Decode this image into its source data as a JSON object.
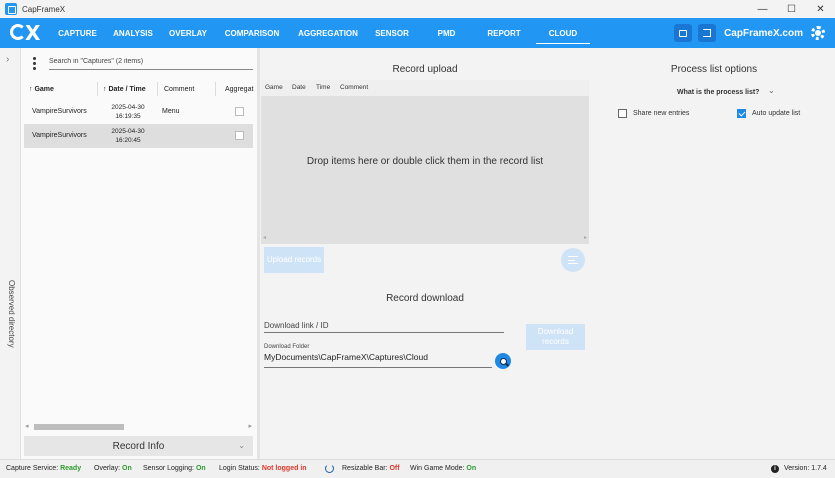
{
  "window": {
    "title": "CapFrameX",
    "controls": [
      "—",
      "☐",
      "✕"
    ]
  },
  "nav": {
    "tabs": [
      {
        "label": "CAPTURE"
      },
      {
        "label": "ANALYSIS"
      },
      {
        "label": "OVERLAY"
      },
      {
        "label": "COMPARISON"
      },
      {
        "label": "AGGREGATION"
      },
      {
        "label": "SENSOR"
      },
      {
        "label": "PMD"
      },
      {
        "label": "REPORT"
      },
      {
        "label": "CLOUD"
      }
    ],
    "active_tab": "CLOUD",
    "site_link": "CapFrameX.com",
    "icons": [
      "screenshot-icon",
      "login-icon",
      "gear-icon"
    ]
  },
  "sidebar": {
    "vertical_label": "Observed directory",
    "toggle": "›"
  },
  "captures": {
    "search_placeholder": "Search in \"Captures\" (2 items)",
    "columns": {
      "game": "Game",
      "date_time": "Date / Time",
      "comment": "Comment",
      "aggregate": "Aggregat"
    },
    "rows": [
      {
        "game": "VampireSurvivors",
        "date": "2025-04-30",
        "time": "16:19:35",
        "comment": "Menu",
        "selected": false
      },
      {
        "game": "VampireSurvivors",
        "date": "2025-04-30",
        "time": "16:20:45",
        "comment": "",
        "selected": true
      }
    ],
    "record_info": "Record Info"
  },
  "upload": {
    "title": "Record upload",
    "columns": {
      "game": "Game",
      "date": "Date",
      "time": "Time",
      "comment": "Comment"
    },
    "drop_text": "Drop items here or double click them in the record list",
    "upload_button": "Upload records"
  },
  "download": {
    "title": "Record download",
    "link_placeholder": "Download link / ID",
    "folder_label": "Download Folder",
    "folder_path": "MyDocuments\\CapFrameX\\Captures\\Cloud",
    "download_button": "Download records"
  },
  "process_list": {
    "title": "Process list options",
    "help_link": "What is the process list?",
    "share_new_entries": {
      "label": "Share new entries",
      "checked": false
    },
    "auto_update": {
      "label": "Auto update list",
      "checked": true
    }
  },
  "status": {
    "capture_service_label": "Capture Service:",
    "capture_service_value": "Ready",
    "overlay_label": "Overlay:",
    "overlay_value": "On",
    "sensor_label": "Sensor Logging:",
    "sensor_value": "On",
    "login_label": "Login Status:",
    "login_value": "Not logged in",
    "resizable_bar_label": "Resizable Bar:",
    "resizable_bar_value": "Off",
    "game_mode_label": "Win Game Mode:",
    "game_mode_value": "On",
    "version_label": "Version:",
    "version_value": "1.7.4"
  },
  "colors": {
    "accent": "#2196f3",
    "ok": "#2e9a2e",
    "error": "#d9362b"
  }
}
